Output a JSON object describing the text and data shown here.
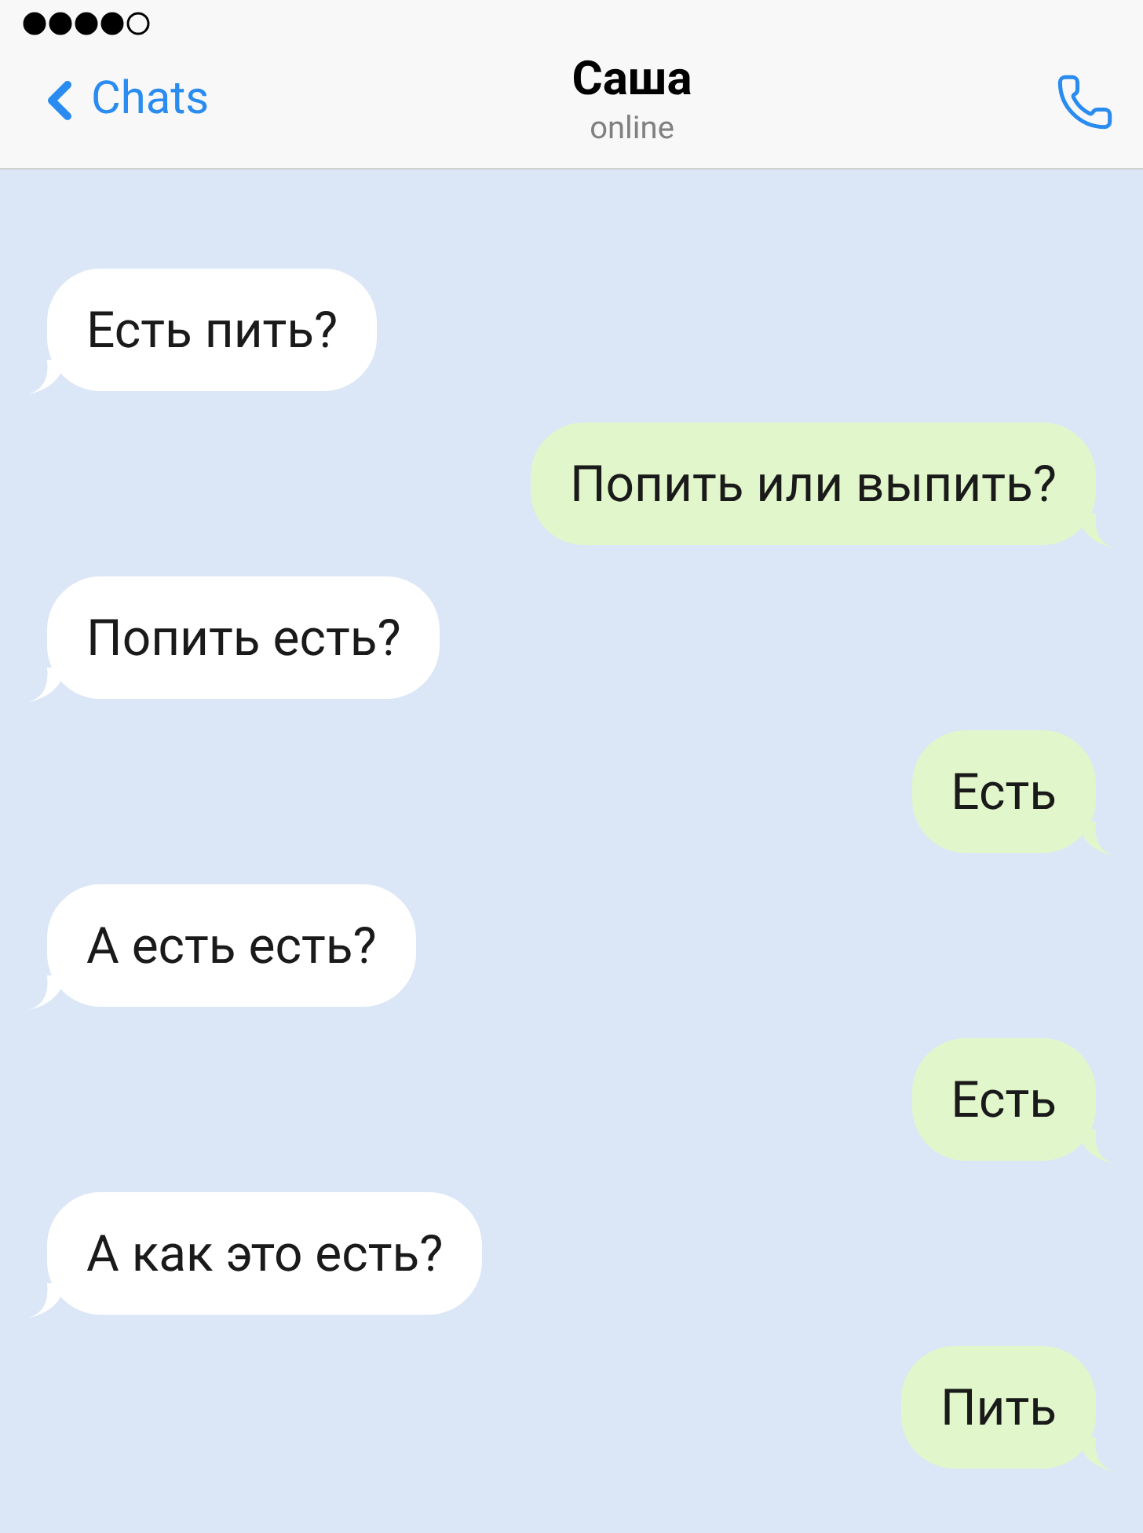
{
  "header": {
    "back_label": "Chats",
    "title": "Саша",
    "subtitle": "online"
  },
  "messages": [
    {
      "kind": "incoming",
      "text": "Есть пить?"
    },
    {
      "kind": "outgoing",
      "text": "Попить или выпить?"
    },
    {
      "kind": "incoming",
      "text": "Попить есть?"
    },
    {
      "kind": "outgoing",
      "text": "Есть"
    },
    {
      "kind": "incoming",
      "text": "А есть есть?"
    },
    {
      "kind": "outgoing",
      "text": "Есть"
    },
    {
      "kind": "incoming",
      "text": "А как это есть?"
    },
    {
      "kind": "outgoing",
      "text": "Пить"
    }
  ]
}
